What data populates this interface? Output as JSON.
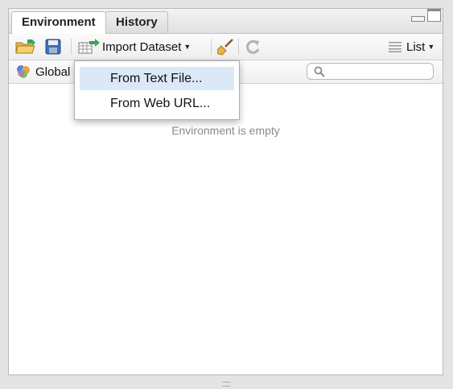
{
  "tabs": [
    {
      "label": "Environment"
    },
    {
      "label": "History"
    }
  ],
  "toolbar": {
    "import_label": "Import Dataset",
    "view_label": "List"
  },
  "envbar": {
    "scope_label": "Global",
    "search_placeholder": ""
  },
  "menu": {
    "items": [
      {
        "label": "From Text File..."
      },
      {
        "label": "From Web URL..."
      }
    ]
  },
  "main": {
    "empty_message": "Environment is empty"
  },
  "colors": {
    "menu_highlight": "#dbe8f7",
    "arrow_green": "#3aa45a"
  },
  "icons": [
    "open-folder-icon",
    "save-icon",
    "import-dataset-icon",
    "broom-icon",
    "refresh-icon",
    "list-icon",
    "environment-icon",
    "search-icon"
  ]
}
